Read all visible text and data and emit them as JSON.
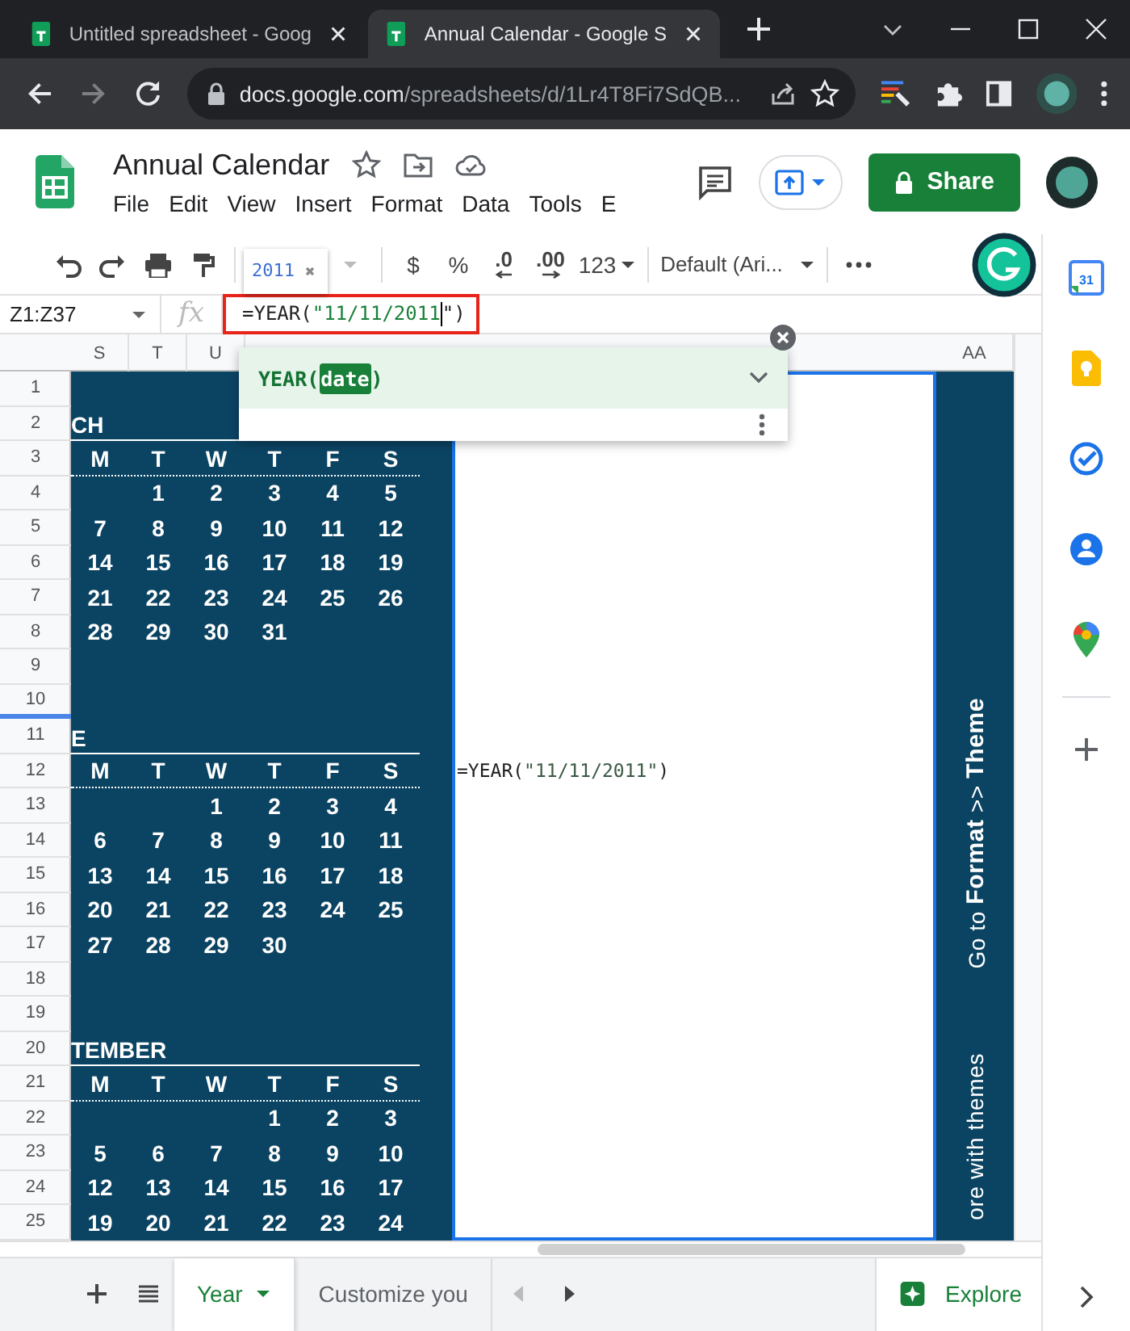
{
  "browser": {
    "tabs": [
      {
        "title": "Untitled spreadsheet - Goog",
        "selected": false
      },
      {
        "title": "Annual Calendar - Google S",
        "selected": true
      }
    ],
    "url": {
      "host": "docs.google.com",
      "path": "/spreadsheets/d/1Lr4T8Fi7SdQB..."
    }
  },
  "document": {
    "title": "Annual Calendar",
    "menu": [
      "File",
      "Edit",
      "View",
      "Insert",
      "Format",
      "Data",
      "Tools",
      "E"
    ],
    "share": "Share"
  },
  "toolbar": {
    "preview_value": "2011",
    "items": [
      {
        "kind": "plain",
        "label": "$"
      },
      {
        "kind": "plain",
        "label": "%"
      },
      {
        "kind": "decimal_less",
        "label": ".0"
      },
      {
        "kind": "decimal_more",
        "label": ".00"
      },
      {
        "kind": "dropdown",
        "label": "123"
      }
    ],
    "font": "Default (Ari..."
  },
  "formula_bar": {
    "name_box": "Z1:Z37",
    "fx": "fx",
    "parts": [
      {
        "kind": "plain",
        "text": "=YEAR("
      },
      {
        "kind": "string",
        "text": "\"11/11/2011"
      },
      {
        "kind": "cursor"
      },
      {
        "kind": "plain",
        "text": "\")"
      }
    ]
  },
  "autocomplete": {
    "parts": [
      {
        "kind": "name",
        "text": "YEAR("
      },
      {
        "kind": "argument",
        "text": "date"
      },
      {
        "kind": "name",
        "text": ")"
      }
    ]
  },
  "grid": {
    "column_headers_left": [
      "S",
      "T",
      "U"
    ],
    "column_header_right": "AA",
    "row_numbers": [
      "1",
      "2",
      "3",
      "4",
      "5",
      "6",
      "7",
      "8",
      "9",
      "10",
      "11",
      "12",
      "13",
      "14",
      "15",
      "16",
      "17",
      "18",
      "19",
      "20",
      "21",
      "22",
      "23",
      "24",
      "25"
    ],
    "months": [
      {
        "title": "CH",
        "weekdays": [
          "M",
          "T",
          "W",
          "T",
          "F",
          "S"
        ],
        "weeks": [
          {
            "kind": "first",
            "days": [
              "1",
              "2",
              "3",
              "4",
              "5"
            ]
          },
          {
            "kind": "regular",
            "days": [
              "7",
              "8",
              "9",
              "10",
              "11",
              "12"
            ]
          },
          {
            "kind": "regular",
            "days": [
              "14",
              "15",
              "16",
              "17",
              "18",
              "19"
            ]
          },
          {
            "kind": "regular",
            "days": [
              "21",
              "22",
              "23",
              "24",
              "25",
              "26"
            ]
          },
          {
            "kind": "regular",
            "days": [
              "28",
              "29",
              "30",
              "31"
            ]
          }
        ]
      },
      {
        "title": "E",
        "weekdays": [
          "M",
          "T",
          "W",
          "T",
          "F",
          "S"
        ],
        "weeks": [
          {
            "kind": "first",
            "days": [
              "1",
              "2",
              "3",
              "4"
            ]
          },
          {
            "kind": "regular",
            "days": [
              "6",
              "7",
              "8",
              "9",
              "10",
              "11"
            ]
          },
          {
            "kind": "regular",
            "days": [
              "13",
              "14",
              "15",
              "16",
              "17",
              "18"
            ]
          },
          {
            "kind": "regular",
            "days": [
              "20",
              "21",
              "22",
              "23",
              "24",
              "25"
            ]
          },
          {
            "kind": "regular",
            "days": [
              "27",
              "28",
              "29",
              "30"
            ]
          }
        ]
      },
      {
        "title": "TEMBER",
        "weekdays": [
          "M",
          "T",
          "W",
          "T",
          "F",
          "S"
        ],
        "weeks": [
          {
            "kind": "first",
            "days": [
              "1",
              "2",
              "3"
            ]
          },
          {
            "kind": "regular",
            "days": [
              "5",
              "6",
              "7",
              "8",
              "9",
              "10"
            ]
          },
          {
            "kind": "regular",
            "days": [
              "12",
              "13",
              "14",
              "15",
              "16",
              "17"
            ]
          },
          {
            "kind": "regular",
            "days": [
              "19",
              "20",
              "21",
              "22",
              "23",
              "24"
            ]
          }
        ]
      }
    ],
    "cell_z12": [
      {
        "kind": "plain",
        "text": "=YEAR("
      },
      {
        "kind": "string",
        "text": "\"11/11/2011\""
      },
      {
        "kind": "plain",
        "text": ")"
      }
    ],
    "banner": [
      "Go to **Format** >> **Theme**",
      "ore with themes"
    ]
  },
  "sheet_tabs": [
    {
      "label": "Year",
      "selected": true
    },
    {
      "label": "Customize you",
      "selected": false
    }
  ],
  "explore": "Explore",
  "side_panel": {
    "calendar_day": "31"
  }
}
